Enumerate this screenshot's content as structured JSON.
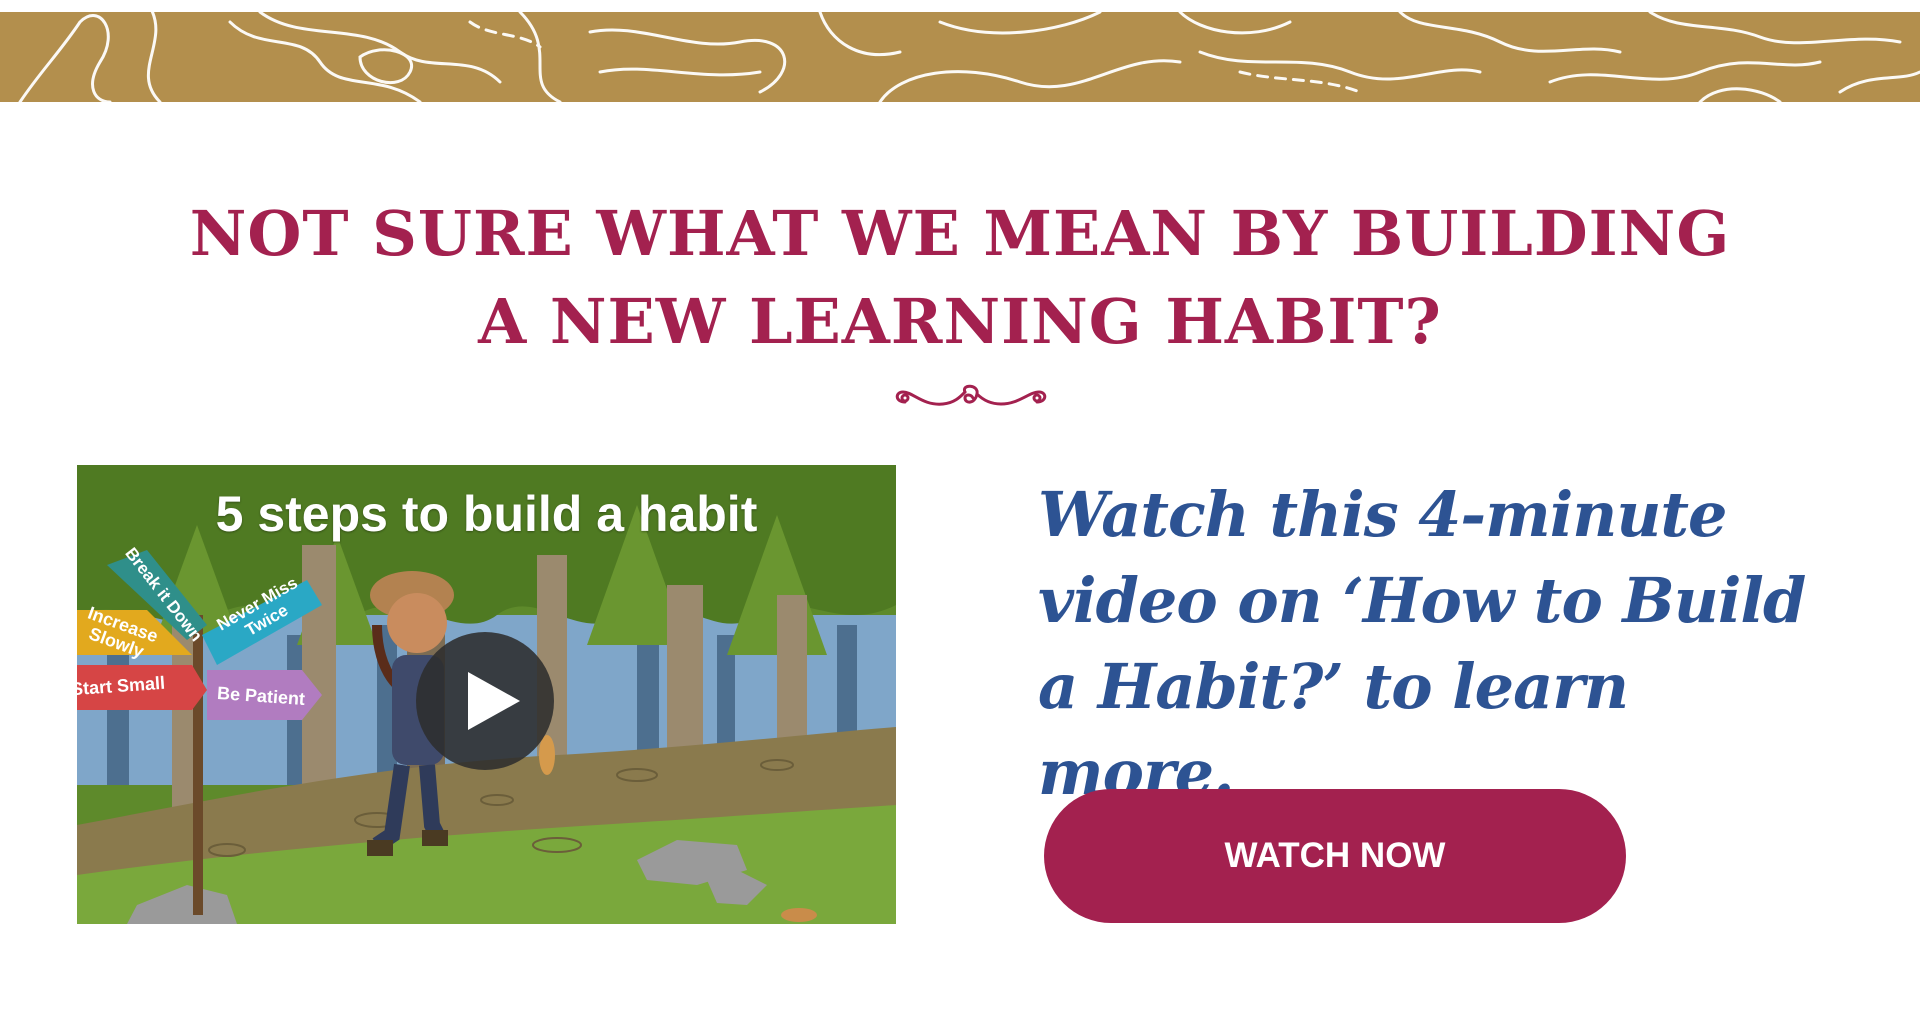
{
  "colors": {
    "accent": "#a3214f",
    "script_text": "#2d5393",
    "band": "#b38f4d"
  },
  "header": {
    "headline_line1": "NOT SURE WHAT WE MEAN BY BUILDING",
    "headline_line2": "A NEW LEARNING HABIT?",
    "divider_icon": "flourish-divider-icon"
  },
  "video": {
    "title": "5 steps to build a habit",
    "signs": {
      "break_it_down": "Break it Down",
      "increase_slowly_line1": "Increase",
      "increase_slowly_line2": "Slowly",
      "never_miss_line1": "Never Miss",
      "never_miss_line2": "Twice",
      "start_small": "Start Small",
      "be_patient": "Be Patient"
    },
    "play_icon": "play-icon"
  },
  "description": {
    "text": "Watch this 4-minute video on ‘How to Build a Habit?’ to learn more."
  },
  "cta": {
    "label": "WATCH NOW"
  }
}
